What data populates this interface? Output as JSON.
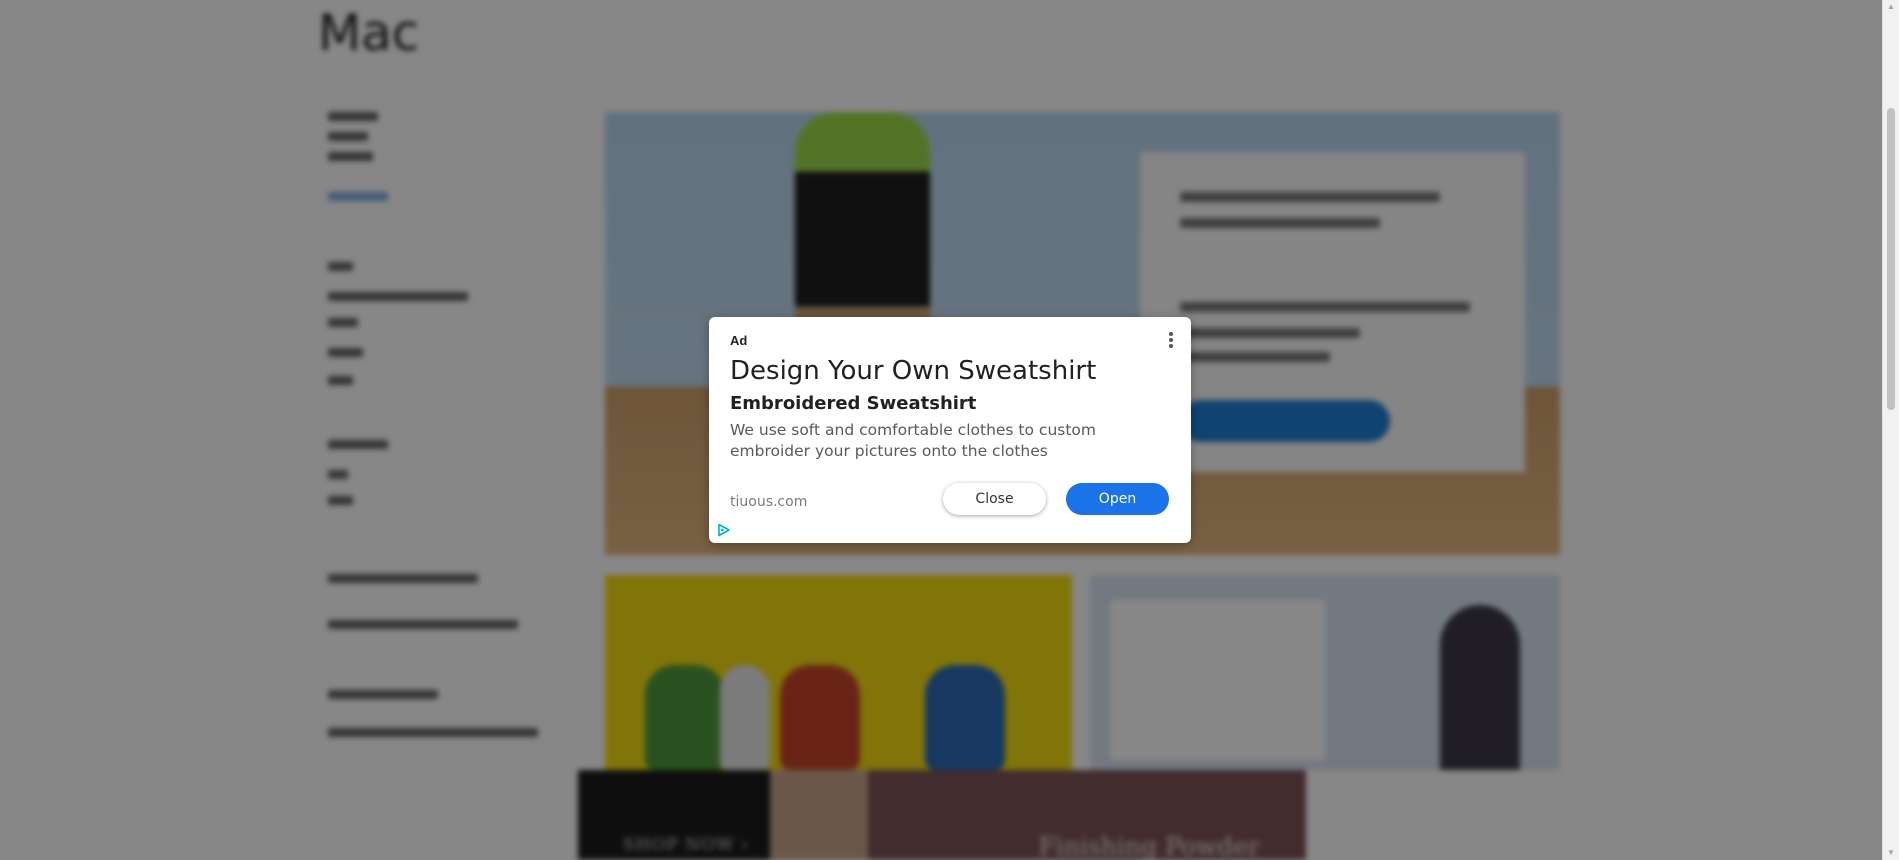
{
  "background_page": {
    "banner_cta": "SHOP NOW ›",
    "banner_title": "Finishing Powder"
  },
  "ad": {
    "label": "Ad",
    "headline": "Design Your Own Sweatshirt",
    "subheadline": "Embroidered Sweatshirt",
    "description": "We use soft and comfortable clothes to custom embroider your pictures onto the clothes",
    "domain": "tiuous.com",
    "close_label": "Close",
    "open_label": "Open",
    "icons": {
      "menu": "more-vertical-icon",
      "adchoices": "adchoices-icon"
    },
    "colors": {
      "open_button": "#1a73e8",
      "adchoices": "#00aecd"
    }
  }
}
